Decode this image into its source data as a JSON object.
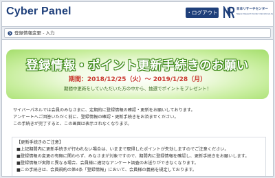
{
  "header": {
    "logo": "Cyber Panel",
    "logout_label": "・ログアウト",
    "org_name": "日本リサーチセンター",
    "org_sub": "Nippon Research Center International Association"
  },
  "breadcrumb": {
    "text": "登録情報変更 - 入力"
  },
  "banner": {
    "title": "登録情報・ポイント更新手続きのお願い",
    "period": "期間：2018/12/25（火）～ 2019/1/28（月）",
    "note": "期間中更新をしていただいた方の中から、抽選でポイントをプレゼント！"
  },
  "intro": [
    "サイバーパネルでは会員のみなさまに、定期的に登録情報の確認・更新をお願いしております。",
    "アンケートへご回答いただく前に、登録情報の確認・更新手続きをお済ませください。",
    "この手続きが完了すると、この画面は表示されなくなります。"
  ],
  "notes": {
    "heading": "【更新手続きのご注意】",
    "items": [
      "■上記期間内に更新手続きが行われない場合は、いままで取得したポイントが失効しますのでご注意ください。",
      "■登録情報の変更の有無に関わらず、みなさまが対象ですので、期間内に登録情報を確認し、更新手続きをお願いします。",
      "■登録情報が実際と異なる場合、会員様に適切なアンケート調査のお送りができなくなります。",
      "■この手続きは、会員規約の第4条「登録情報」において、会員様の義務を規定しております。"
    ]
  },
  "colors": {
    "brand": "#1e3f7a",
    "banner_green": "#a4de6b",
    "period_red": "#c9362e"
  }
}
